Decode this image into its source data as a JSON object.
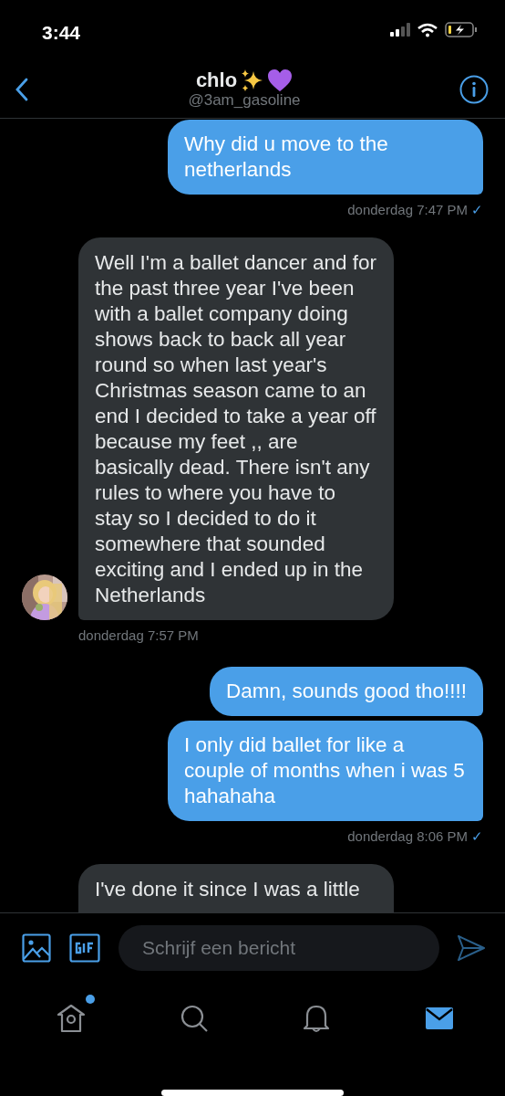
{
  "status_bar": {
    "time": "3:44"
  },
  "header": {
    "name": "chlo",
    "handle": "@3am_gasoline"
  },
  "groups": [
    {
      "kind": "outgoing",
      "bubbles": [
        "Why did u move to the netherlands"
      ],
      "timestamp": "donderdag 7:47 PM",
      "read_mark": "✓"
    },
    {
      "kind": "incoming",
      "avatar": {
        "kind": "picture"
      },
      "bubbles": [
        "Well I'm a ballet dancer and for the past three year I've been with a ballet company doing shows back to back all year round so when last year's Christmas season came to an end I decided to take a year off because my feet ,, are basically dead. There isn't any rules to where you have to stay so I decided to do it somewhere that sounded exciting and I ended up in the Netherlands"
      ],
      "timestamp": "donderdag 7:57 PM"
    },
    {
      "kind": "outgoing",
      "bubbles": [
        "Damn, sounds good tho!!!!",
        "I only did ballet for like a couple of months when i was 5 hahahaha"
      ],
      "timestamp": "donderdag 8:06 PM",
      "read_mark": "✓"
    },
    {
      "kind": "incoming",
      "bubbles": [
        "I've done it since I was a little"
      ]
    }
  ],
  "composer": {
    "placeholder": "Schrijf een bericht"
  },
  "tab_bar": [
    {
      "kind": "home",
      "selected": false,
      "badge": true
    },
    {
      "kind": "search",
      "selected": false,
      "badge": false
    },
    {
      "kind": "notifications",
      "selected": false,
      "badge": false
    },
    {
      "kind": "messages",
      "selected": true,
      "badge": false
    }
  ]
}
